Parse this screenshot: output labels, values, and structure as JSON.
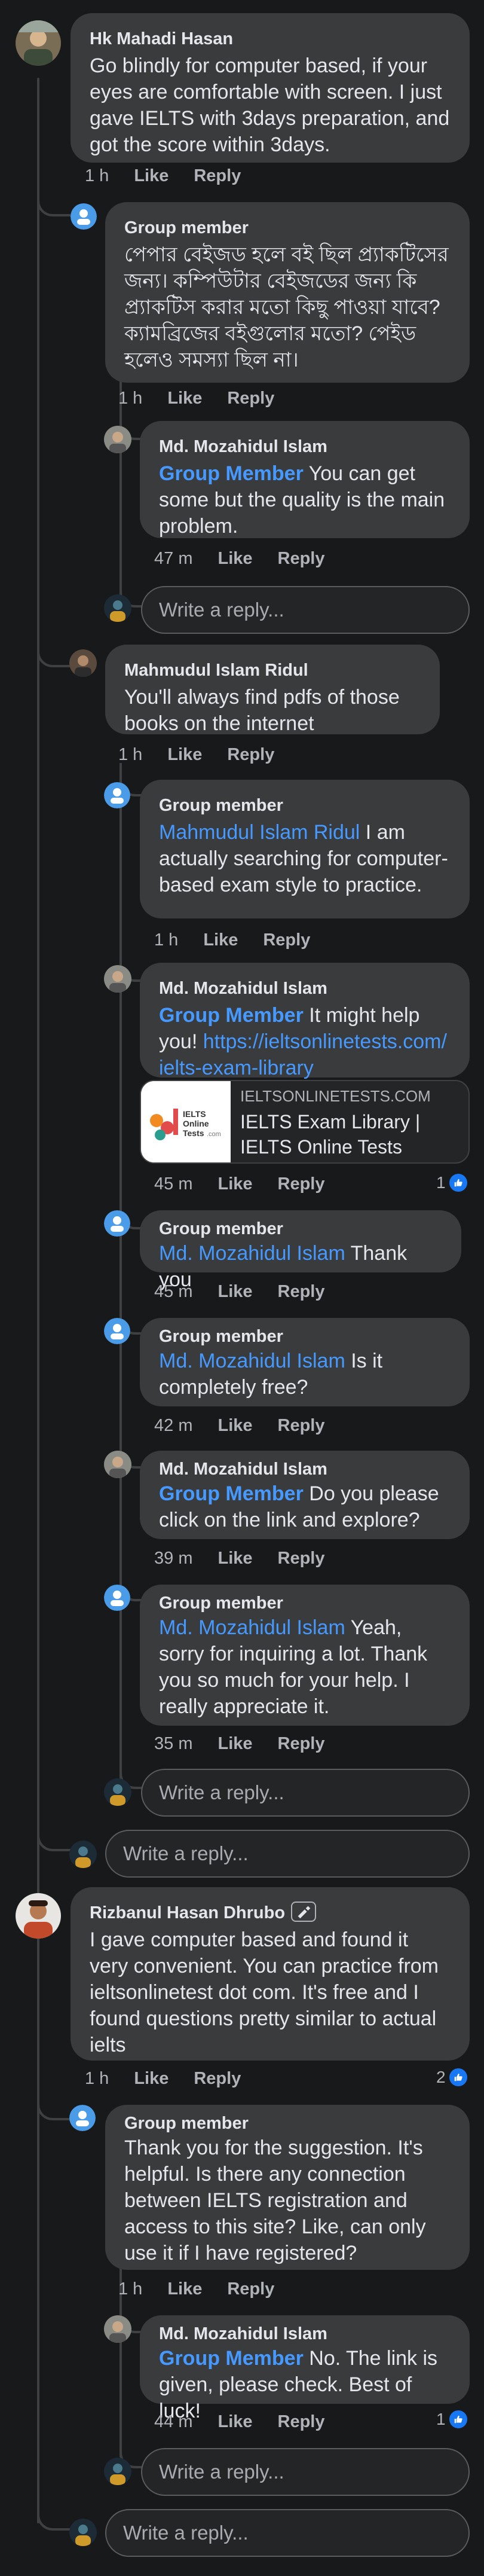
{
  "labels": {
    "like": "Like",
    "reply": "Reply",
    "write_reply": "Write a reply..."
  },
  "c1": {
    "name": "Hk Mahadi Hasan",
    "text": "Go blindly for computer based, if your eyes are comfortable with screen. I just gave IELTS with 3days preparation, and got the score within 3days.",
    "time": "1 h"
  },
  "c1r1": {
    "name": "Group member",
    "text": "পেপার বেইজড হলে বই ছিল প্র্যাকটিসের জন্য। কম্পিউটার বেইজডের জন্য কি প্র্যাকটিস করার মতো কিছু পাওয়া যাবে? ক্যামব্রিজের বইগুলোর মতো? পেইড হলেও সমস্যা ছিল না।",
    "time": "1 h"
  },
  "c1r2": {
    "name": "Md. Mozahidul Islam",
    "tag": "Group Member",
    "text": " You can get some but the quality is the main problem.",
    "time": "47 m"
  },
  "c2": {
    "name": "Mahmudul Islam Ridul",
    "text": "You'll always find pdfs of those books on the internet",
    "time": "1 h"
  },
  "c2r1": {
    "name": "Group member",
    "tag": "Mahmudul Islam Ridul",
    "text": " I am actually searching for computer-based exam style to practice.",
    "time": "1 h"
  },
  "c2r2": {
    "name": "Md. Mozahidul Islam",
    "tag": "Group Member",
    "text": " It might help you! ",
    "url": "https://ieltsonlinetests.com/ielts-exam-library",
    "time": "45 m",
    "reactions": "1",
    "link": {
      "domain": "IELTSONLINETESTS.COM",
      "title": "IELTS Exam Library | IELTS Online Tests",
      "logo_line1": "IELTS",
      "logo_line2": "Online",
      "logo_line3": "Tests",
      "logo_suffix": ".com"
    }
  },
  "c2r3": {
    "name": "Group member",
    "tag": "Md. Mozahidul Islam",
    "text": " Thank you",
    "time": "45 m"
  },
  "c2r4": {
    "name": "Group member",
    "tag": "Md. Mozahidul Islam",
    "text": " Is it completely free?",
    "time": "42 m"
  },
  "c2r5": {
    "name": "Md. Mozahidul Islam",
    "tag": "Group Member",
    "text": " Do you please click on the link and explore?",
    "time": "39 m"
  },
  "c2r6": {
    "name": "Group member",
    "tag": "Md. Mozahidul Islam",
    "text": " Yeah, sorry for inquiring a lot. Thank you so much for your help. I really appreciate it.",
    "time": "35 m"
  },
  "c3": {
    "name": "Rizbanul Hasan Dhrubo",
    "text": "I gave computer based and found it very convenient. You can practice from ieltsonlinetest dot com. It's free and I found questions pretty similar to actual ielts",
    "time": "1 h",
    "reactions": "2"
  },
  "c3r1": {
    "name": "Group member",
    "text": "Thank you for the suggestion. It's helpful. Is there any connection between IELTS registration and access to this site? Like, can only use it if I have registered?",
    "time": "1 h"
  },
  "c3r2": {
    "name": "Md. Mozahidul Islam",
    "tag": "Group Member",
    "text": " No. The link is given, please check. Best of luck!",
    "time": "44 m",
    "reactions": "1"
  },
  "colors": {
    "background": "#18191a",
    "bubble": "#3a3b3c",
    "link": "#4599ff",
    "like_badge": "#1877f2"
  }
}
